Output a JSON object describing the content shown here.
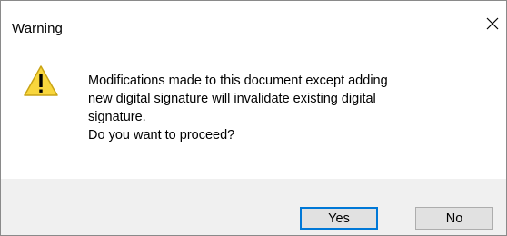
{
  "window": {
    "title": "Warning"
  },
  "icons": {
    "warning": "warning-triangle-icon",
    "close": "close-icon"
  },
  "message": {
    "lines": [
      "Modifications made to this document except adding",
      "new digital signature will invalidate existing digital",
      "signature.",
      "Do you want to proceed?"
    ]
  },
  "buttons": {
    "yes_label": "Yes",
    "no_label": "No"
  },
  "colors": {
    "warning_fill": "#f8d63d",
    "warning_stroke": "#c9a415",
    "default_button_border": "#0078d7",
    "footer_background": "#f0f0f0",
    "button_background": "#e1e1e1"
  }
}
